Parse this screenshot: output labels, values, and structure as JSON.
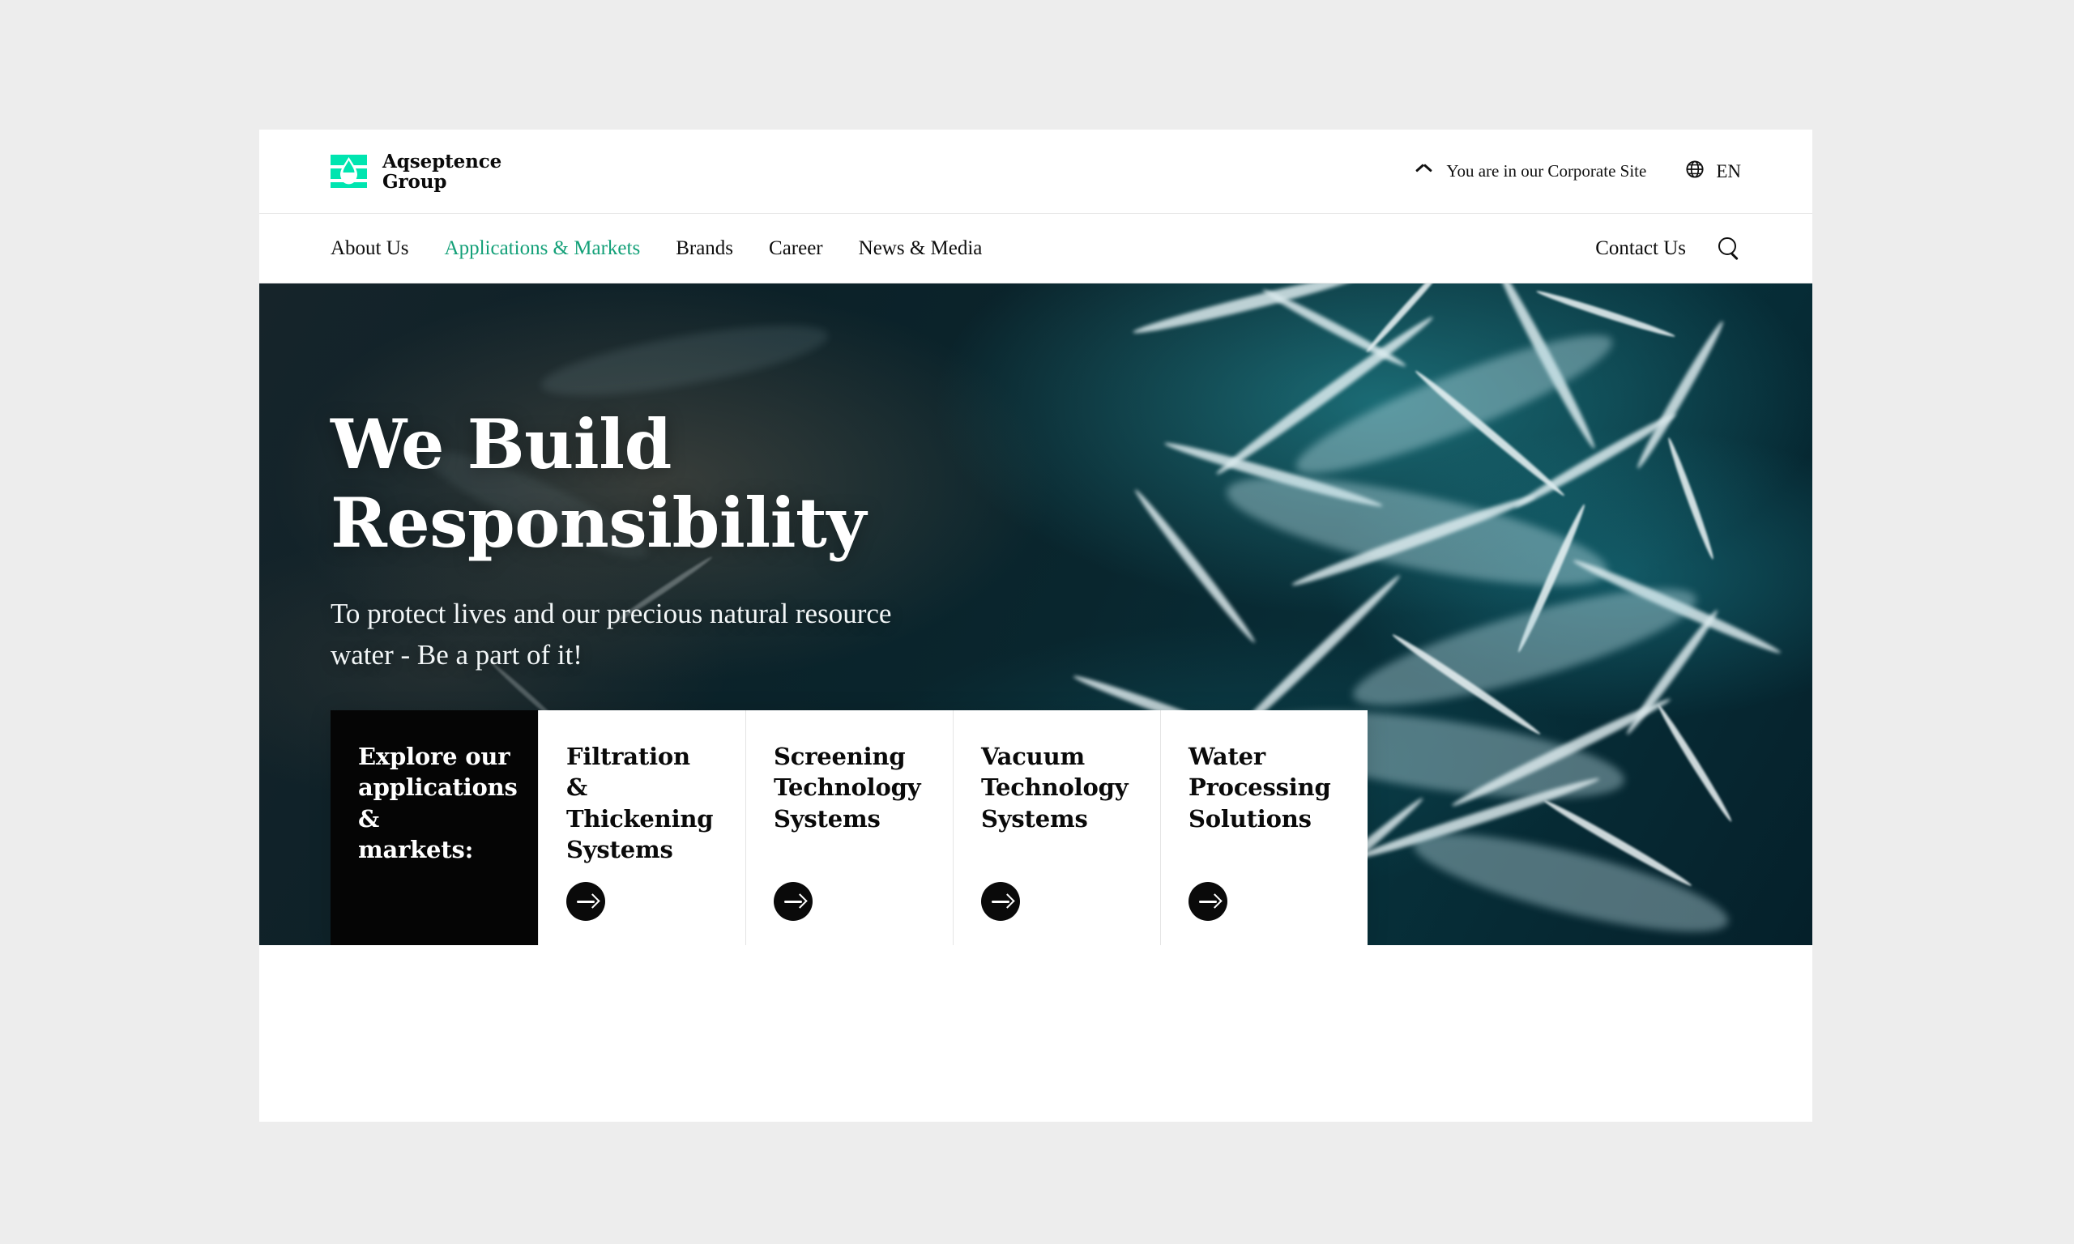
{
  "brand": {
    "name": "Aqseptence\nGroup",
    "logo_color": "#00e5b0",
    "logo_icon": "water-droplet-logo"
  },
  "utility_bar": {
    "chevron_icon": "chevron-up-icon",
    "site_notice": "You are in our Corporate Site",
    "globe_icon": "globe-icon",
    "language": "EN"
  },
  "nav": {
    "items": [
      {
        "label": "About Us",
        "active": false
      },
      {
        "label": "Applications & Markets",
        "active": true
      },
      {
        "label": "Brands",
        "active": false
      },
      {
        "label": "Career",
        "active": false
      },
      {
        "label": "News & Media",
        "active": false
      }
    ],
    "contact_label": "Contact Us",
    "search_icon": "search-icon",
    "active_color": "#13a078"
  },
  "hero": {
    "title": "We Build\nResponsibility",
    "subtitle": "To protect lives and our precious natural resource\nwater - Be a part of it!",
    "background_image": "aerial-ocean-water-foam"
  },
  "cards": {
    "lead": {
      "title": "Explore our\napplications &\nmarkets:",
      "background": "#050505"
    },
    "items": [
      {
        "title": "Filtration &\nThickening\nSystems",
        "arrow_icon": "arrow-right-icon"
      },
      {
        "title": "Screening\nTechnology\nSystems",
        "arrow_icon": "arrow-right-icon"
      },
      {
        "title": "Vacuum\nTechnology\nSystems",
        "arrow_icon": "arrow-right-icon"
      },
      {
        "title": "Water\nProcessing\nSolutions",
        "arrow_icon": "arrow-right-icon"
      }
    ]
  }
}
